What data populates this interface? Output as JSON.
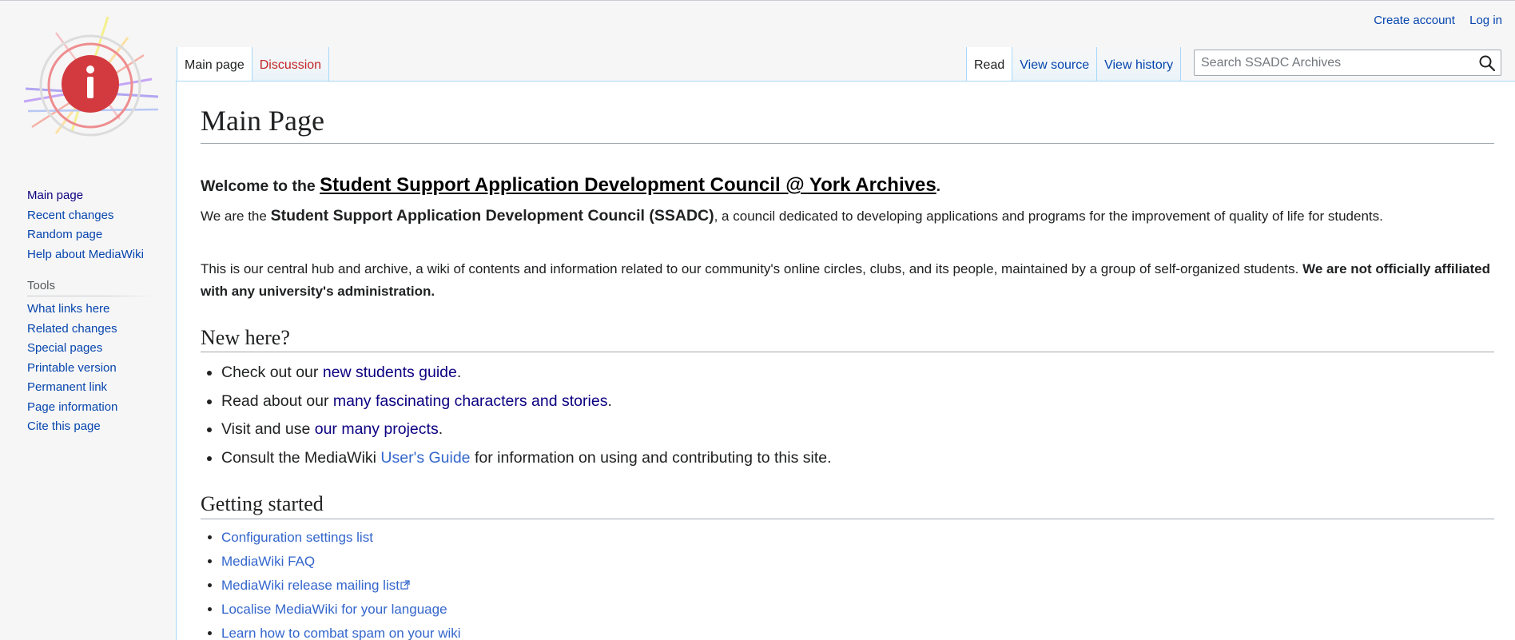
{
  "personal_tools": {
    "create_account": "Create account",
    "log_in": "Log in"
  },
  "tabs": {
    "main_page": "Main page",
    "discussion": "Discussion",
    "read": "Read",
    "view_source": "View source",
    "view_history": "View history"
  },
  "search": {
    "placeholder": "Search SSADC Archives"
  },
  "sidebar": {
    "navigation": [
      "Main page",
      "Recent changes",
      "Random page",
      "Help about MediaWiki"
    ],
    "tools_heading": "Tools",
    "tools": [
      "What links here",
      "Related changes",
      "Special pages",
      "Printable version",
      "Permanent link",
      "Page information",
      "Cite this page"
    ]
  },
  "content": {
    "title": "Main Page",
    "welcome_prefix": "Welcome to the ",
    "welcome_site": "Student Support Application Development Council @ York Archives",
    "welcome_suffix": ".",
    "intro_prefix": "We are the ",
    "intro_name": "Student Support Application Development Council (SSADC)",
    "intro_suffix": ", a council dedicated to developing applications and programs for the improvement of quality of life for students.",
    "hub_text": "This is our central hub and archive, a wiki of contents and information related to our community's online circles, clubs, and its people, maintained by a group of self-organized students. ",
    "hub_bold": "We are not officially affiliated with any university's administration.",
    "new_here": {
      "heading": "New here?",
      "item1_prefix": "Check out our ",
      "item1_link": "new students guide",
      "item1_suffix": ".",
      "item2_prefix": "Read about our ",
      "item2_link": "many fascinating characters and stories",
      "item2_suffix": ".",
      "item3_prefix": "Visit and use ",
      "item3_link": "our many projects",
      "item3_suffix": ".",
      "item4_prefix": "Consult the MediaWiki ",
      "item4_link": "User's Guide",
      "item4_suffix": " for information on using and contributing to this site."
    },
    "getting_started": {
      "heading": "Getting started",
      "links": [
        "Configuration settings list",
        "MediaWiki FAQ",
        "MediaWiki release mailing list",
        "Localise MediaWiki for your language",
        "Learn how to combat spam on your wiki"
      ]
    }
  },
  "colors": {
    "link": "#3366cc",
    "visited_link": "#0b0080",
    "new_link": "#ba0000",
    "tab_border": "#a7d7f9",
    "logo_red": "#d33a3f"
  },
  "icons": {
    "logo": "mediawiki-info-logo",
    "search": "search-icon",
    "external_link": "external-link-icon"
  }
}
